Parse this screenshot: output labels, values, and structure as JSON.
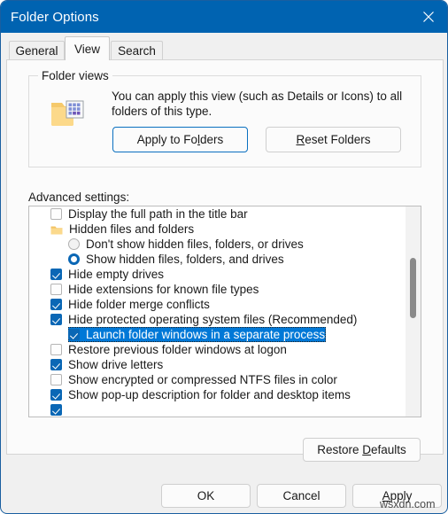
{
  "window": {
    "title": "Folder Options",
    "close_icon": "close-icon",
    "titlebar_color": "#0063b1"
  },
  "tabs": [
    {
      "label": "General",
      "active": false
    },
    {
      "label": "View",
      "active": true
    },
    {
      "label": "Search",
      "active": false
    }
  ],
  "folder_views": {
    "legend": "Folder views",
    "description": "You can apply this view (such as Details or Icons) to all folders of this type.",
    "icon": "folder-with-icons-view-icon",
    "apply_button": "Apply to Folders",
    "apply_button_accel": "l",
    "reset_button": "Reset Folders",
    "reset_button_accel": "R",
    "focus_color": "#0a70c0"
  },
  "advanced": {
    "label": "Advanced settings:",
    "selection_color": "#0078d7",
    "checked_color": "#0a67b5",
    "items": [
      {
        "label": "Display the full path in the title bar",
        "control": "checkbox",
        "checked": false,
        "indent": 0,
        "selected": false
      },
      {
        "label": "Hidden files and folders",
        "control": "folder",
        "checked": false,
        "indent": 0,
        "selected": false
      },
      {
        "label": "Don't show hidden files, folders, or drives",
        "control": "radio",
        "checked": false,
        "indent": 1,
        "selected": false
      },
      {
        "label": "Show hidden files, folders, and drives",
        "control": "radio",
        "checked": true,
        "indent": 1,
        "selected": false
      },
      {
        "label": "Hide empty drives",
        "control": "checkbox",
        "checked": true,
        "indent": 0,
        "selected": false
      },
      {
        "label": "Hide extensions for known file types",
        "control": "checkbox",
        "checked": false,
        "indent": 0,
        "selected": false
      },
      {
        "label": "Hide folder merge conflicts",
        "control": "checkbox",
        "checked": true,
        "indent": 0,
        "selected": false
      },
      {
        "label": "Hide protected operating system files (Recommended)",
        "control": "checkbox",
        "checked": true,
        "indent": 0,
        "selected": false
      },
      {
        "label": "Launch folder windows in a separate process",
        "control": "checkbox",
        "checked": true,
        "indent": 0,
        "selected": true
      },
      {
        "label": "Restore previous folder windows at logon",
        "control": "checkbox",
        "checked": false,
        "indent": 0,
        "selected": false
      },
      {
        "label": "Show drive letters",
        "control": "checkbox",
        "checked": true,
        "indent": 0,
        "selected": false
      },
      {
        "label": "Show encrypted or compressed NTFS files in color",
        "control": "checkbox",
        "checked": false,
        "indent": 0,
        "selected": false
      },
      {
        "label": "Show pop-up description for folder and desktop items",
        "control": "checkbox",
        "checked": true,
        "indent": 0,
        "selected": false
      },
      {
        "label": "",
        "control": "checkbox",
        "checked": true,
        "indent": 0,
        "selected": false
      }
    ],
    "scrollbar": {
      "thumb_top_pct": 24,
      "thumb_height_pct": 29
    }
  },
  "restore_defaults": {
    "label": "Restore Defaults",
    "accel": "D"
  },
  "footer": {
    "ok": "OK",
    "cancel": "Cancel",
    "apply": "Apply",
    "apply_accel": "A"
  },
  "watermark": "wsxdn.com"
}
